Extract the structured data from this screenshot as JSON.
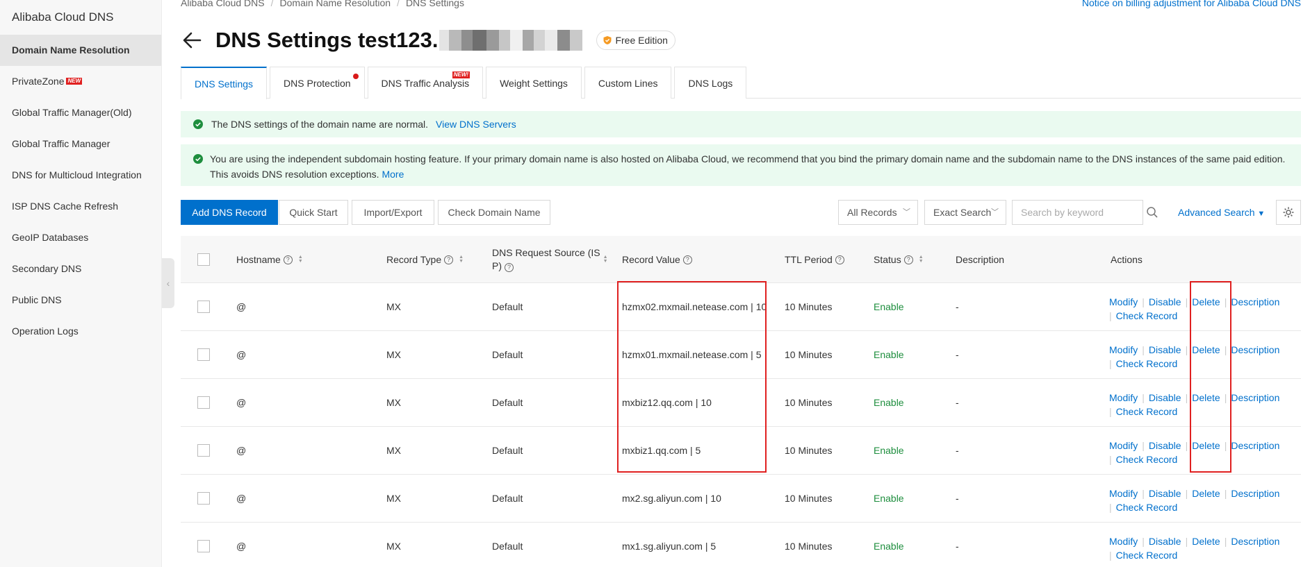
{
  "sidebar": {
    "title": "Alibaba Cloud DNS",
    "items": [
      {
        "label": "Domain Name Resolution",
        "active": true
      },
      {
        "label": "PrivateZone",
        "badge": "NEW"
      },
      {
        "label": "Global Traffic Manager(Old)"
      },
      {
        "label": "Global Traffic Manager"
      },
      {
        "label": "DNS for Multicloud Integration"
      },
      {
        "label": "ISP DNS Cache Refresh"
      },
      {
        "label": "GeoIP Databases"
      },
      {
        "label": "Secondary DNS"
      },
      {
        "label": "Public DNS"
      },
      {
        "label": "Operation Logs"
      }
    ]
  },
  "breadcrumb": [
    "Alibaba Cloud DNS",
    "Domain Name Resolution",
    "DNS Settings"
  ],
  "notice_link": "Notice on billing adjustment for Alibaba Cloud DNS",
  "page": {
    "title": "DNS Settings test123.",
    "edition": "Free Edition"
  },
  "tabs": [
    {
      "label": "DNS Settings",
      "active": true
    },
    {
      "label": "DNS Protection",
      "dot": true
    },
    {
      "label": "DNS Traffic Analysis",
      "badge": "NEW!"
    },
    {
      "label": "Weight Settings"
    },
    {
      "label": "Custom Lines"
    },
    {
      "label": "DNS Logs"
    }
  ],
  "alerts": {
    "normal_text": "The DNS settings of the domain name are normal.",
    "normal_link": "View DNS Servers",
    "subdomain_text": "You are using the independent subdomain hosting feature. If your primary domain name is also hosted on Alibaba Cloud, we recommend that you bind the primary domain name and the subdomain name to the DNS instances of the same paid edition. This avoids DNS resolution exceptions.",
    "subdomain_link": "More"
  },
  "toolbar": {
    "add_record": "Add DNS Record",
    "quick_start": "Quick Start",
    "import_export": "Import/Export",
    "check_domain": "Check Domain Name",
    "records_filter": "All Records",
    "search_mode": "Exact Search",
    "search_placeholder": "Search by keyword",
    "advanced_search": "Advanced Search"
  },
  "table": {
    "columns": {
      "hostname": "Hostname",
      "record_type": "Record Type",
      "request_source_l1": "DNS Request Source (IS",
      "request_source_l2": "P)",
      "record_value": "Record Value",
      "ttl": "TTL Period",
      "status": "Status",
      "description": "Description",
      "actions": "Actions"
    },
    "action_labels": {
      "modify": "Modify",
      "disable": "Disable",
      "delete": "Delete",
      "description": "Description",
      "check_record": "Check Record"
    },
    "rows": [
      {
        "hostname": "@",
        "type": "MX",
        "source": "Default",
        "value": "hzmx02.mxmail.netease.com | 10",
        "ttl": "10 Minutes",
        "status": "Enable",
        "description": "-"
      },
      {
        "hostname": "@",
        "type": "MX",
        "source": "Default",
        "value": "hzmx01.mxmail.netease.com | 5",
        "ttl": "10 Minutes",
        "status": "Enable",
        "description": "-"
      },
      {
        "hostname": "@",
        "type": "MX",
        "source": "Default",
        "value": "mxbiz12.qq.com | 10",
        "ttl": "10 Minutes",
        "status": "Enable",
        "description": "-"
      },
      {
        "hostname": "@",
        "type": "MX",
        "source": "Default",
        "value": "mxbiz1.qq.com | 5",
        "ttl": "10 Minutes",
        "status": "Enable",
        "description": "-"
      },
      {
        "hostname": "@",
        "type": "MX",
        "source": "Default",
        "value": "mx2.sg.aliyun.com | 10",
        "ttl": "10 Minutes",
        "status": "Enable",
        "description": "-"
      },
      {
        "hostname": "@",
        "type": "MX",
        "source": "Default",
        "value": "mx1.sg.aliyun.com | 5",
        "ttl": "10 Minutes",
        "status": "Enable",
        "description": "-"
      }
    ]
  },
  "colors": {
    "accent": "#0070cc",
    "success": "#1e8e3e",
    "highlight": "#e02020"
  }
}
